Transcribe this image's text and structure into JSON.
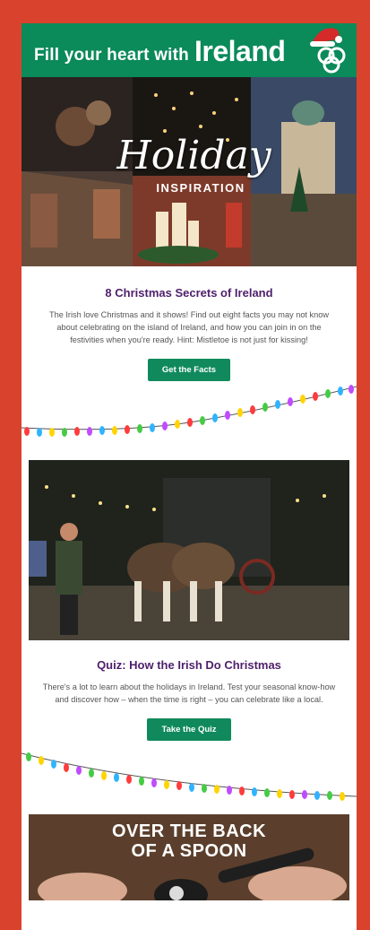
{
  "header": {
    "tagline": "Fill your heart with",
    "brand": "Ireland"
  },
  "hero": {
    "title": "Holiday",
    "subtitle": "INSPIRATION"
  },
  "article1": {
    "title": "8 Christmas Secrets of Ireland",
    "body": "The Irish love Christmas and it shows! Find out eight facts you may not know about celebrating on the island of Ireland, and how you can join in on the festivities when you're ready. Hint: Mistletoe is not just for kissing!",
    "button": "Get the Facts"
  },
  "article2": {
    "title": "Quiz: How the Irish Do Christmas",
    "body": "There's a lot to learn about the holidays in Ireland. Test your seasonal know-how and discover how – when the time is right – you can celebrate like a local.",
    "button": "Take the Quiz"
  },
  "article3": {
    "title_line1": "OVER THE BACK",
    "title_line2": "OF A SPOON"
  },
  "colors": {
    "page_bg": "#d9432e",
    "brand_green": "#0b8a5a",
    "heading_purple": "#4e1f6b"
  }
}
